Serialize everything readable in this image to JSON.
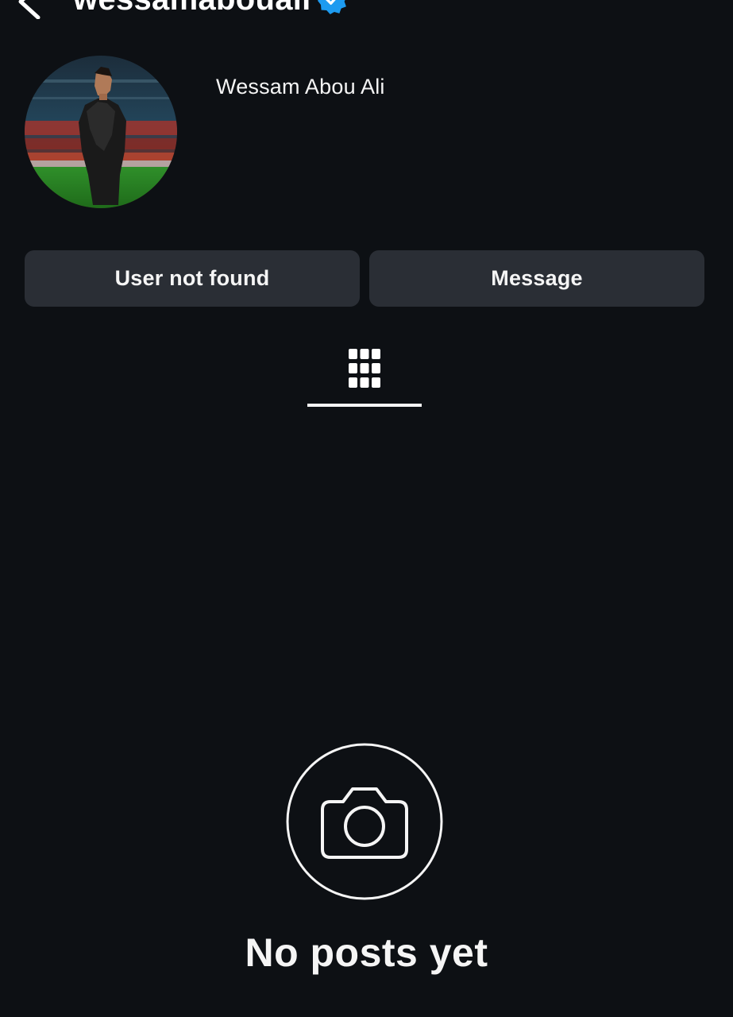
{
  "header": {
    "username": "wessamabouali",
    "back_icon": "chevron-left-icon",
    "verified_icon": "verified-badge-icon",
    "more_icon": "more-horizontal-icon",
    "verified_color": "#1d9bf0"
  },
  "profile": {
    "display_name": "Wessam Abou Ali",
    "avatar": "profile-photo"
  },
  "actions": {
    "primary_label": "User not found",
    "secondary_label": "Message"
  },
  "tabs": [
    {
      "icon": "grid-icon",
      "selected": true
    }
  ],
  "empty_state": {
    "icon": "camera-icon",
    "title": "No posts yet"
  },
  "colors": {
    "background": "#0d1014",
    "button": "#2a2e35",
    "text": "#f5f5f5"
  }
}
